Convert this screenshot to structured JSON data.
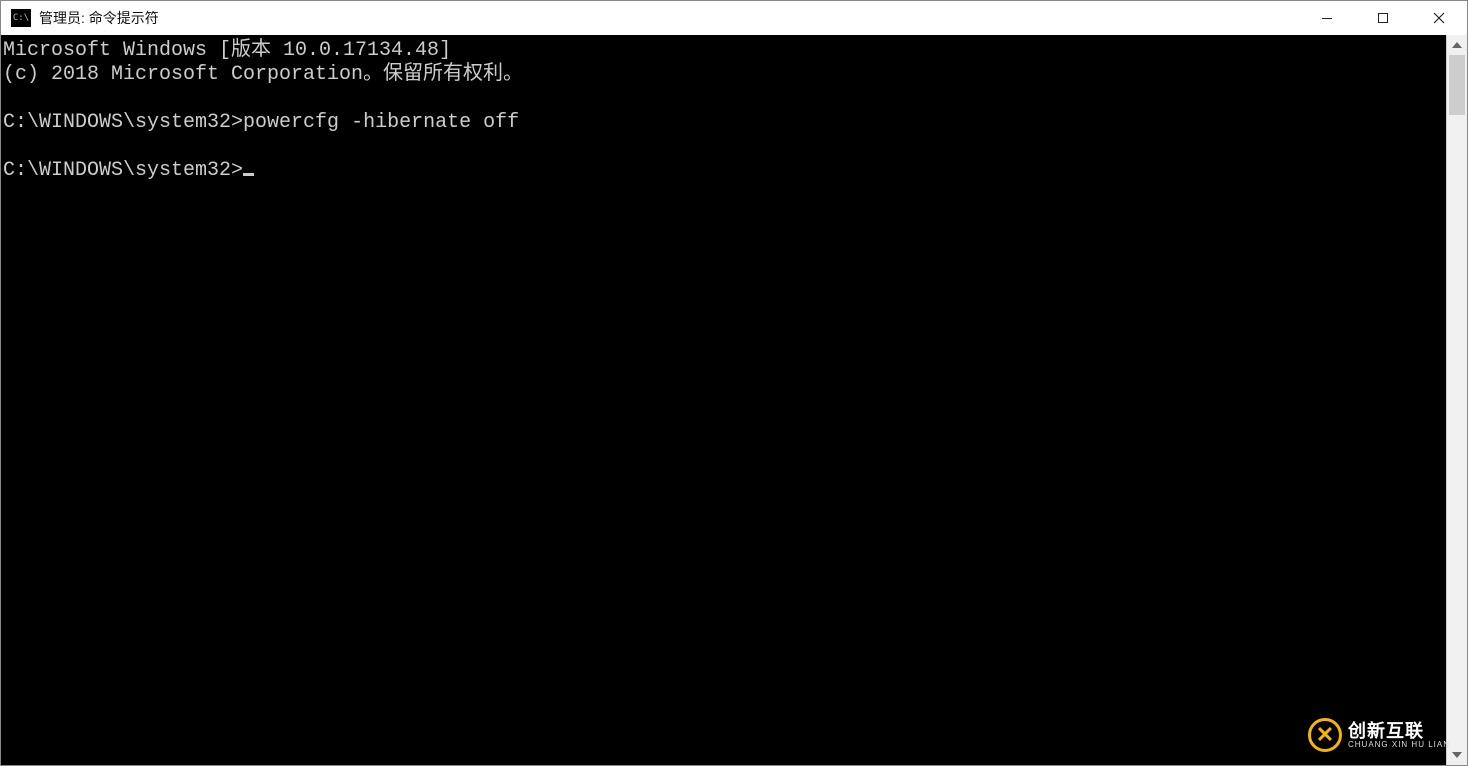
{
  "title": "管理员: 命令提示符",
  "terminal": {
    "line1": "Microsoft Windows [版本 10.0.17134.48]",
    "line2": "(c) 2018 Microsoft Corporation。保留所有权利。",
    "blank1": "",
    "line3_prompt": "C:\\WINDOWS\\system32>",
    "line3_cmd": "powercfg -hibernate off",
    "blank2": "",
    "line4_prompt": "C:\\WINDOWS\\system32>"
  },
  "watermark": {
    "big": "创新互联",
    "small": "CHUANG XIN HU LIAN"
  }
}
